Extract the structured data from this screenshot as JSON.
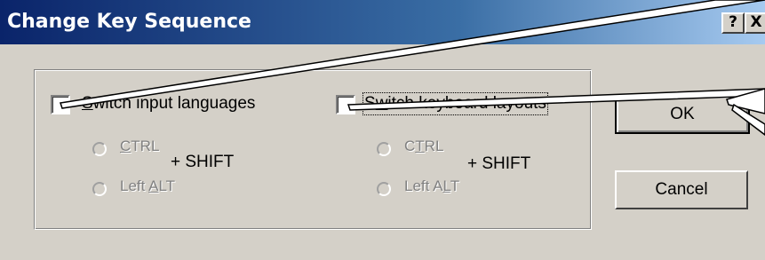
{
  "window": {
    "title": "Change Key Sequence",
    "help_button": "?",
    "close_button": "X"
  },
  "group": {
    "input_languages": {
      "label": "Switch input languages",
      "checked": false,
      "hotkey_letter": "S"
    },
    "keyboard_layouts": {
      "label": "Switch keyboard layouts",
      "checked": false,
      "hotkey_letter": "w"
    },
    "left_radios": {
      "ctrl": "CTRL",
      "alt": "Left ALT",
      "plus_shift": "+  SHIFT"
    },
    "right_radios": {
      "ctrl": "CTRL",
      "alt": "Left ALT",
      "plus_shift": "+  SHIFT"
    }
  },
  "buttons": {
    "ok": "OK",
    "cancel": "Cancel"
  }
}
